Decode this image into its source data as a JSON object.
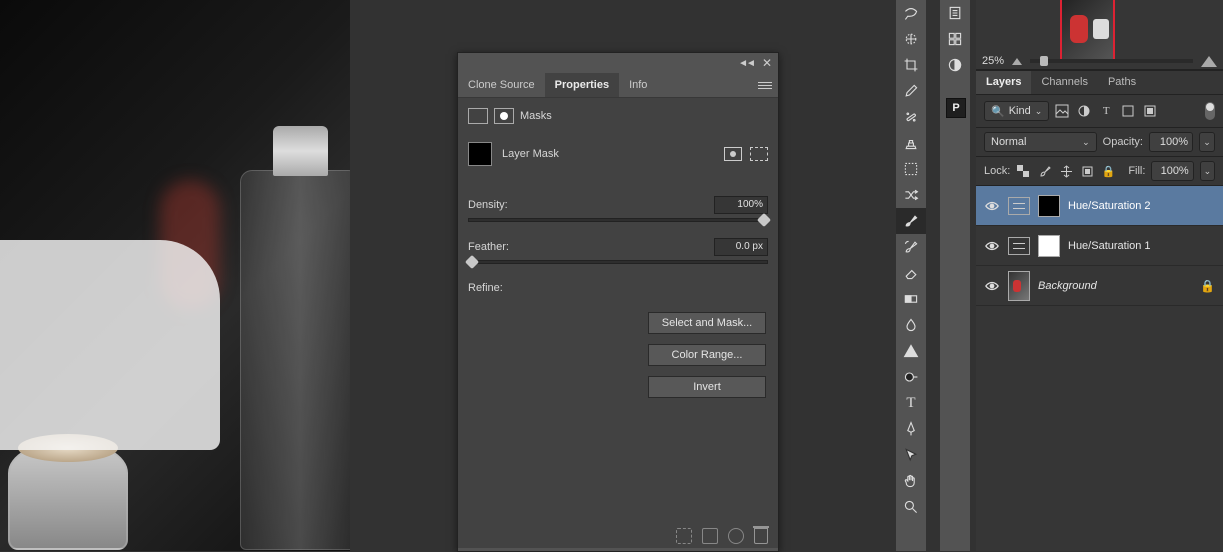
{
  "panel": {
    "tabs": {
      "clone": "Clone Source",
      "props": "Properties",
      "info": "Info"
    },
    "masksLabel": "Masks",
    "maskType": "Layer Mask",
    "density": {
      "label": "Density:",
      "value": "100%"
    },
    "feather": {
      "label": "Feather:",
      "value": "0.0 px"
    },
    "refineLabel": "Refine:",
    "buttons": {
      "selectMask": "Select and Mask...",
      "colorRange": "Color Range...",
      "invert": "Invert"
    }
  },
  "navigator": {
    "zoom": "25%"
  },
  "layersPanel": {
    "tabs": {
      "layers": "Layers",
      "channels": "Channels",
      "paths": "Paths"
    },
    "kind": "Kind",
    "blendMode": "Normal",
    "opacityLabel": "Opacity:",
    "opacityValue": "100%",
    "lockLabel": "Lock:",
    "fillLabel": "Fill:",
    "fillValue": "100%",
    "layers": [
      {
        "name": "Hue/Saturation 2"
      },
      {
        "name": "Hue/Saturation 1"
      },
      {
        "name": "Background"
      }
    ]
  },
  "propsBadge": "P"
}
